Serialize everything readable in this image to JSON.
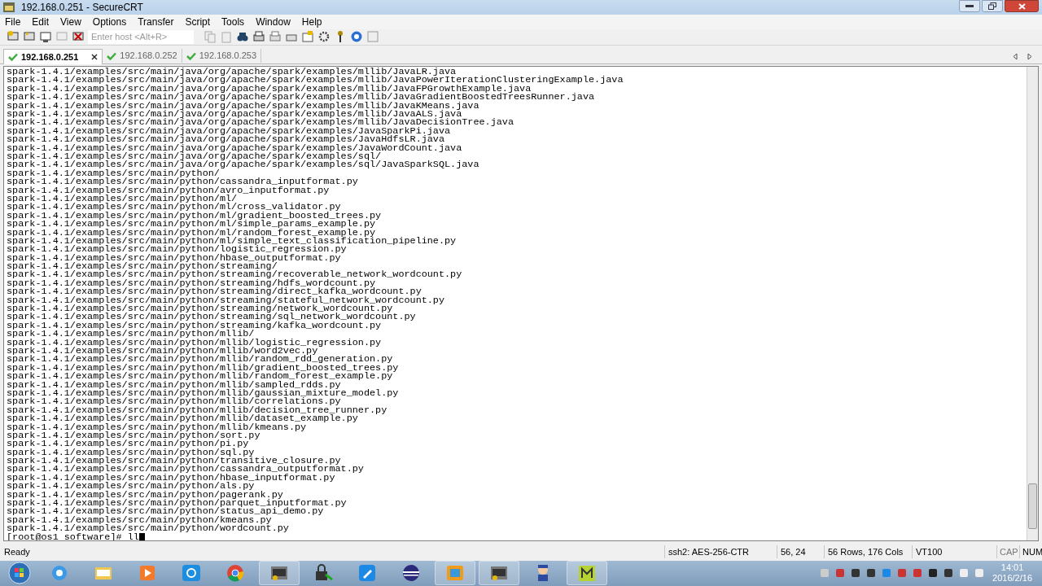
{
  "window": {
    "title": "192.168.0.251 - SecureCRT"
  },
  "menu": [
    "File",
    "Edit",
    "View",
    "Options",
    "Transfer",
    "Script",
    "Tools",
    "Window",
    "Help"
  ],
  "toolbar": {
    "host_placeholder": "Enter host <Alt+R>"
  },
  "tabs": [
    {
      "label": "192.168.0.251",
      "selected": true,
      "connected": true
    },
    {
      "label": "192.168.0.252",
      "selected": false,
      "connected": true
    },
    {
      "label": "192.168.0.253",
      "selected": false,
      "connected": true
    }
  ],
  "terminal": {
    "lines": [
      "spark-1.4.1/examples/src/main/java/org/apache/spark/examples/mllib/JavaLR.java",
      "spark-1.4.1/examples/src/main/java/org/apache/spark/examples/mllib/JavaPowerIterationClusteringExample.java",
      "spark-1.4.1/examples/src/main/java/org/apache/spark/examples/mllib/JavaFPGrowthExample.java",
      "spark-1.4.1/examples/src/main/java/org/apache/spark/examples/mllib/JavaGradientBoostedTreesRunner.java",
      "spark-1.4.1/examples/src/main/java/org/apache/spark/examples/mllib/JavaKMeans.java",
      "spark-1.4.1/examples/src/main/java/org/apache/spark/examples/mllib/JavaALS.java",
      "spark-1.4.1/examples/src/main/java/org/apache/spark/examples/mllib/JavaDecisionTree.java",
      "spark-1.4.1/examples/src/main/java/org/apache/spark/examples/JavaSparkPi.java",
      "spark-1.4.1/examples/src/main/java/org/apache/spark/examples/JavaHdfsLR.java",
      "spark-1.4.1/examples/src/main/java/org/apache/spark/examples/JavaWordCount.java",
      "spark-1.4.1/examples/src/main/java/org/apache/spark/examples/sql/",
      "spark-1.4.1/examples/src/main/java/org/apache/spark/examples/sql/JavaSparkSQL.java",
      "spark-1.4.1/examples/src/main/python/",
      "spark-1.4.1/examples/src/main/python/cassandra_inputformat.py",
      "spark-1.4.1/examples/src/main/python/avro_inputformat.py",
      "spark-1.4.1/examples/src/main/python/ml/",
      "spark-1.4.1/examples/src/main/python/ml/cross_validator.py",
      "spark-1.4.1/examples/src/main/python/ml/gradient_boosted_trees.py",
      "spark-1.4.1/examples/src/main/python/ml/simple_params_example.py",
      "spark-1.4.1/examples/src/main/python/ml/random_forest_example.py",
      "spark-1.4.1/examples/src/main/python/ml/simple_text_classification_pipeline.py",
      "spark-1.4.1/examples/src/main/python/logistic_regression.py",
      "spark-1.4.1/examples/src/main/python/hbase_outputformat.py",
      "spark-1.4.1/examples/src/main/python/streaming/",
      "spark-1.4.1/examples/src/main/python/streaming/recoverable_network_wordcount.py",
      "spark-1.4.1/examples/src/main/python/streaming/hdfs_wordcount.py",
      "spark-1.4.1/examples/src/main/python/streaming/direct_kafka_wordcount.py",
      "spark-1.4.1/examples/src/main/python/streaming/stateful_network_wordcount.py",
      "spark-1.4.1/examples/src/main/python/streaming/network_wordcount.py",
      "spark-1.4.1/examples/src/main/python/streaming/sql_network_wordcount.py",
      "spark-1.4.1/examples/src/main/python/streaming/kafka_wordcount.py",
      "spark-1.4.1/examples/src/main/python/mllib/",
      "spark-1.4.1/examples/src/main/python/mllib/logistic_regression.py",
      "spark-1.4.1/examples/src/main/python/mllib/word2vec.py",
      "spark-1.4.1/examples/src/main/python/mllib/random_rdd_generation.py",
      "spark-1.4.1/examples/src/main/python/mllib/gradient_boosted_trees.py",
      "spark-1.4.1/examples/src/main/python/mllib/random_forest_example.py",
      "spark-1.4.1/examples/src/main/python/mllib/sampled_rdds.py",
      "spark-1.4.1/examples/src/main/python/mllib/gaussian_mixture_model.py",
      "spark-1.4.1/examples/src/main/python/mllib/correlations.py",
      "spark-1.4.1/examples/src/main/python/mllib/decision_tree_runner.py",
      "spark-1.4.1/examples/src/main/python/mllib/dataset_example.py",
      "spark-1.4.1/examples/src/main/python/mllib/kmeans.py",
      "spark-1.4.1/examples/src/main/python/sort.py",
      "spark-1.4.1/examples/src/main/python/pi.py",
      "spark-1.4.1/examples/src/main/python/sql.py",
      "spark-1.4.1/examples/src/main/python/transitive_closure.py",
      "spark-1.4.1/examples/src/main/python/cassandra_outputformat.py",
      "spark-1.4.1/examples/src/main/python/hbase_inputformat.py",
      "spark-1.4.1/examples/src/main/python/als.py",
      "spark-1.4.1/examples/src/main/python/pagerank.py",
      "spark-1.4.1/examples/src/main/python/parquet_inputformat.py",
      "spark-1.4.1/examples/src/main/python/status_api_demo.py",
      "spark-1.4.1/examples/src/main/python/kmeans.py",
      "spark-1.4.1/examples/src/main/python/wordcount.py"
    ],
    "prompt": "[root@os1 software]# ll"
  },
  "status_bar": {
    "message": "Ready",
    "cipher": "ssh2: AES-256-CTR",
    "cursor": "56, 24",
    "size": "56 Rows, 176 Cols",
    "emulation": "VT100",
    "caps": "CAP",
    "num": "NUM"
  },
  "taskbar": {
    "time": "14:01",
    "date": "2016/2/16"
  }
}
